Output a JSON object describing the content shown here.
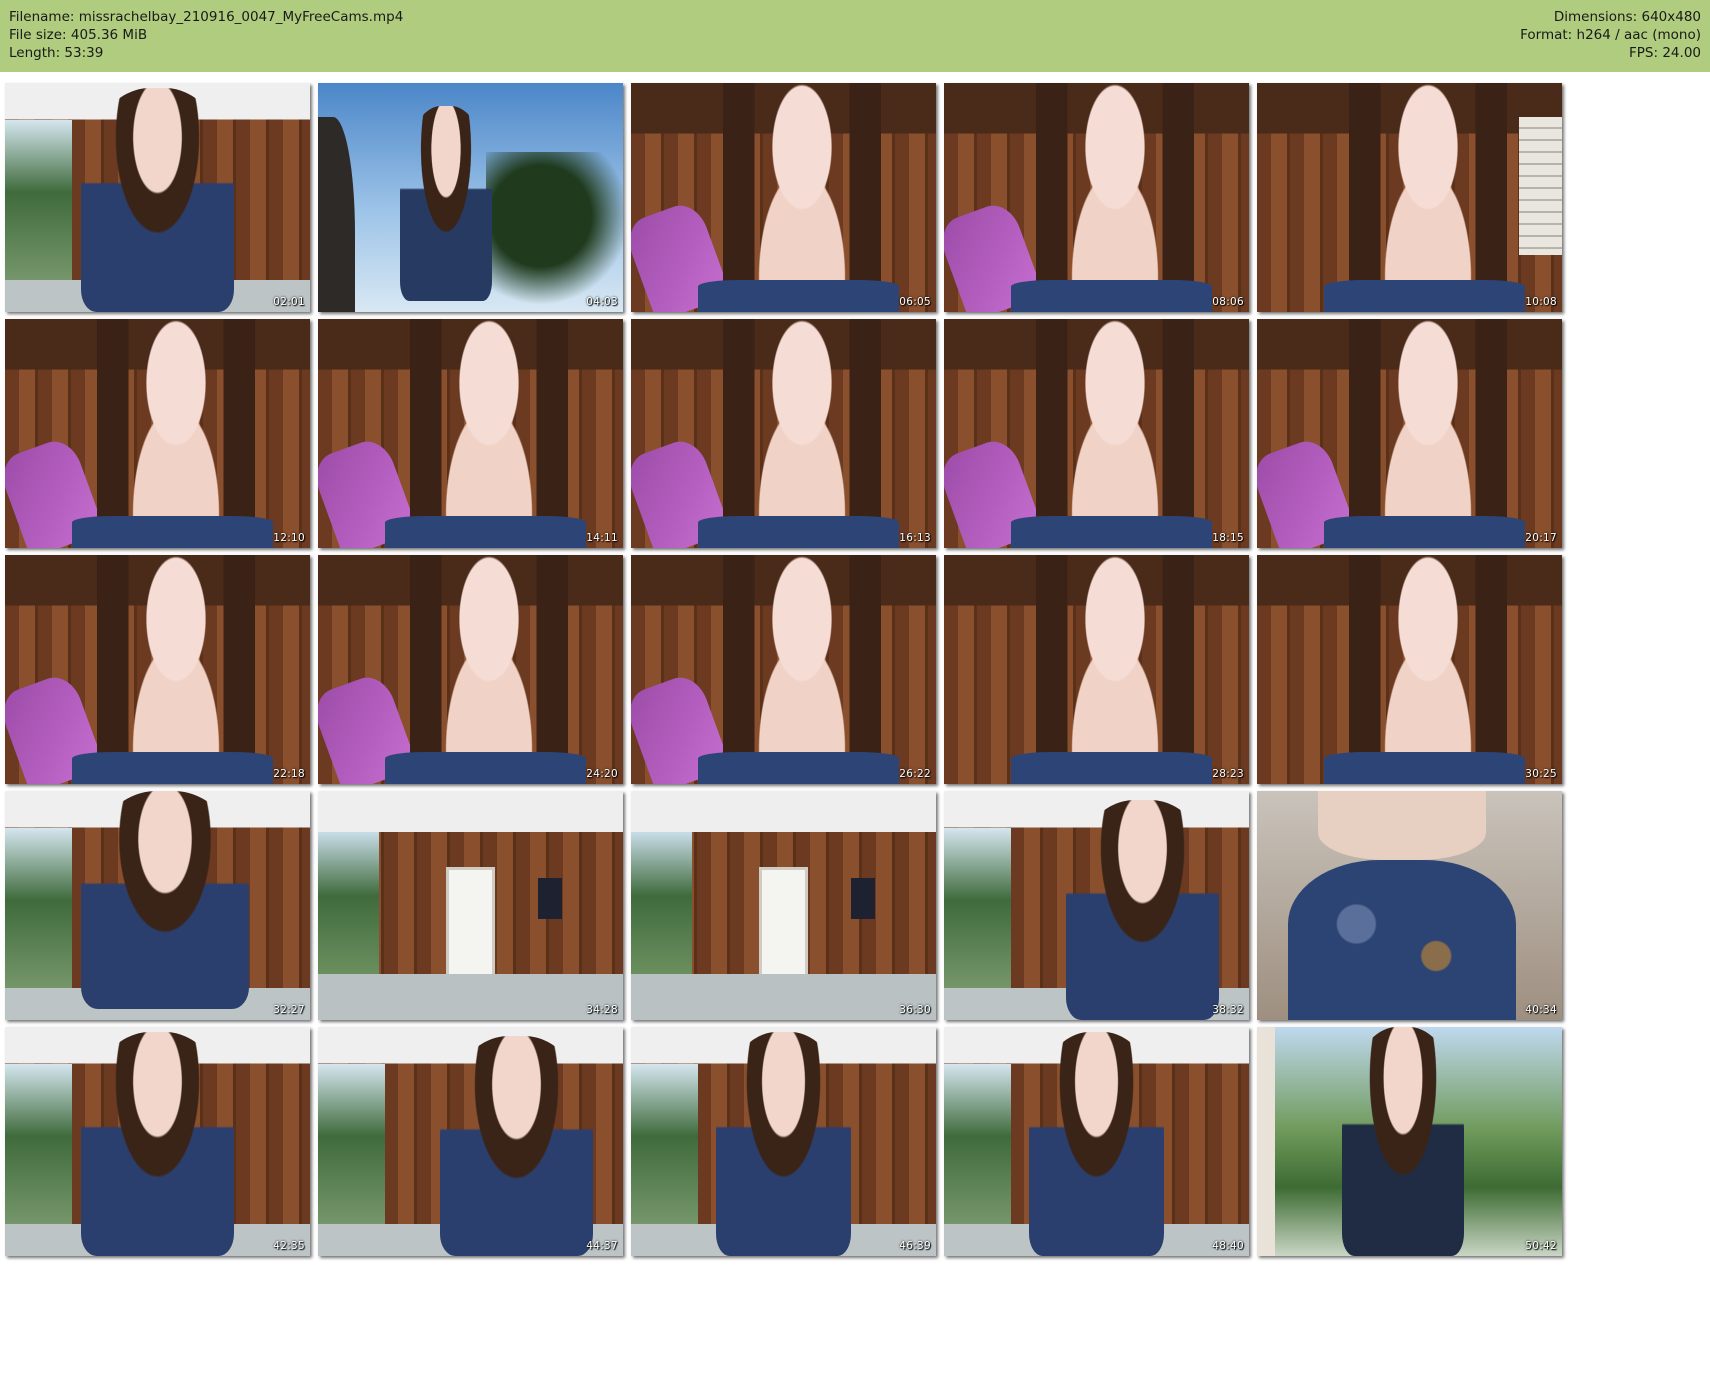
{
  "header": {
    "filename_label": "Filename: missrachelbay_210916_0047_MyFreeCams.mp4",
    "filesize_label": "File size: 405.36 MiB",
    "length_label": "Length: 53:39",
    "dimensions_label": "Dimensions: 640x480",
    "format_label": "Format: h264 / aac (mono)",
    "fps_label": "FPS: 24.00",
    "background_color": "#b0cc7e"
  },
  "thumbnails": [
    {
      "time": "02:01",
      "scene": "garage-door-open-woman-left"
    },
    {
      "time": "04:03",
      "scene": "outdoor-sky-low-angle"
    },
    {
      "time": "06:05",
      "scene": "closeup-wood-wall-purple-chair"
    },
    {
      "time": "08:06",
      "scene": "closeup-wood-wall-purple-chair"
    },
    {
      "time": "10:08",
      "scene": "closeup-wood-wall-shelf"
    },
    {
      "time": "12:10",
      "scene": "closeup-wood-wall-purple-chair"
    },
    {
      "time": "14:11",
      "scene": "closeup-wood-wall-purple-chair"
    },
    {
      "time": "16:13",
      "scene": "closeup-wood-wall-purple-chair"
    },
    {
      "time": "18:15",
      "scene": "closeup-wood-wall-purple-chair"
    },
    {
      "time": "20:17",
      "scene": "closeup-wood-wall-purple-chair"
    },
    {
      "time": "22:18",
      "scene": "closeup-wood-wall-purple-chair"
    },
    {
      "time": "24:20",
      "scene": "closeup-wood-wall-purple-chair"
    },
    {
      "time": "26:22",
      "scene": "closeup-wood-wall-purple-chair"
    },
    {
      "time": "28:23",
      "scene": "closeup-wood-wall"
    },
    {
      "time": "30:25",
      "scene": "closeup-wood-wall"
    },
    {
      "time": "32:27",
      "scene": "garage-door-open-leaning"
    },
    {
      "time": "34:28",
      "scene": "garage-empty"
    },
    {
      "time": "36:30",
      "scene": "garage-empty"
    },
    {
      "time": "38:32",
      "scene": "garage-door-open-woman-right"
    },
    {
      "time": "40:34",
      "scene": "blurred-dress-closeup"
    },
    {
      "time": "42:35",
      "scene": "garage-door-open-woman-left"
    },
    {
      "time": "44:37",
      "scene": "garage-door-open-woman-right"
    },
    {
      "time": "46:39",
      "scene": "garage-pigtails-center"
    },
    {
      "time": "48:40",
      "scene": "garage-pigtails-center"
    },
    {
      "time": "50:42",
      "scene": "outdoor-full-body-dress"
    }
  ]
}
